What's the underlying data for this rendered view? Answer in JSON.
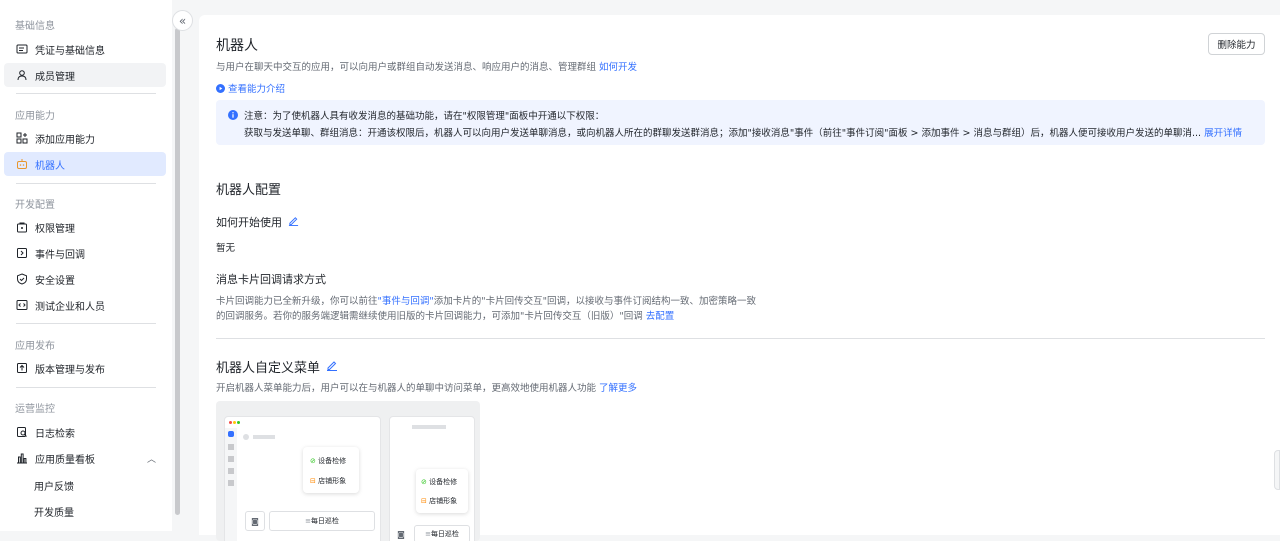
{
  "sidebar": {
    "groups": {
      "basic": "基础信息",
      "app_ability": "应用能力",
      "dev_config": "开发配置",
      "release": "应用发布",
      "ops": "运营监控"
    },
    "items": {
      "credentials": "凭证与基础信息",
      "members": "成员管理",
      "add_ability": "添加应用能力",
      "bot": "机器人",
      "permissions": "权限管理",
      "events": "事件与回调",
      "security": "安全设置",
      "test_company": "测试企业和人员",
      "version": "版本管理与发布",
      "logs": "日志检索",
      "quality": "应用质量看板",
      "feedback": "用户反馈",
      "dev_quality": "开发质量"
    },
    "collapse_icon": "«"
  },
  "main": {
    "title": "机器人",
    "desc": "与用户在聊天中交互的应用，可以向用户或群组自动发送消息、响应用户的消息、管理群组",
    "desc_link": "如何开发",
    "view_intro": "查看能力介绍",
    "delete_button": "删除能力",
    "notice": {
      "line1": "注意：为了使机器人具有收发消息的基础功能，请在\"权限管理\"面板中开通以下权限：",
      "line2": "获取与发送单聊、群组消息：开通该权限后，机器人可以向用户发送单聊消息，或向机器人所在的群聊发送群消息；添加\"接收消息\"事件（前往\"事件订阅\"面板 > 添加事件 > 消息与群组）后，机器人便可接收用户发送的单聊消...",
      "expand": "展开详情"
    },
    "config": {
      "title": "机器人配置",
      "how_to_use": "如何开始使用",
      "how_to_use_value": "暂无",
      "card_title": "消息卡片回调请求方式",
      "card_desc1_a": "卡片回调能力已全新升级，你可以前往",
      "card_desc1_link": "\"事件与回调\"",
      "card_desc1_b": "添加卡片的\"卡片回传交互\"回调，以接收与事件订阅结构一致、加密策略一致",
      "card_desc2": "的回调服务。若你的服务端逻辑需继续使用旧版的卡片回调能力，可添加\"卡片回传交互（旧版）\"回调",
      "card_desc2_link": "去配置"
    },
    "menu": {
      "title": "机器人自定义菜单",
      "desc": "开启机器人菜单能力后，用户可以在与机器人的单聊中访问菜单，更高效地使用机器人功能",
      "desc_link": "了解更多",
      "preview": {
        "item1": "设备检修",
        "item2": "店铺形象",
        "bottom": "每日巡检"
      }
    }
  },
  "colors": {
    "accent": "#3370ff",
    "active_bg": "#e1eaff",
    "notice_bg": "#f0f4ff"
  }
}
